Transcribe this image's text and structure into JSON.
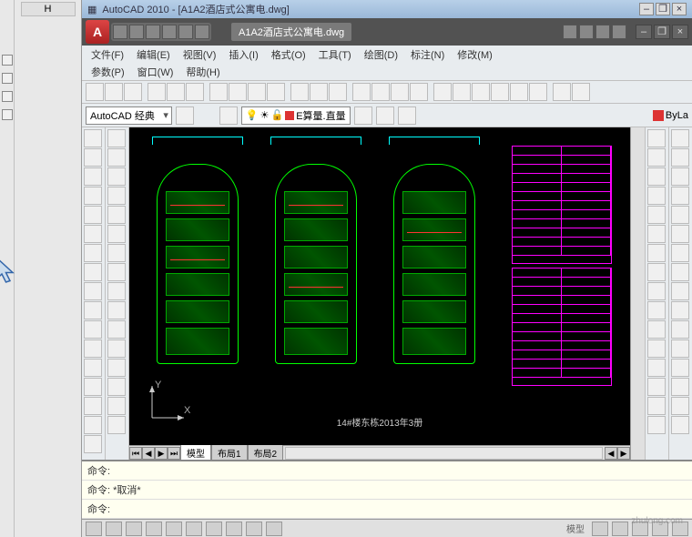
{
  "app": {
    "title": "AutoCAD 2010 - [A1A2酒店式公寓电.dwg]"
  },
  "doctab": "A1A2酒店式公寓电.dwg",
  "col_header": "H",
  "menu": {
    "file": "文件(F)",
    "edit": "编辑(E)",
    "view": "视图(V)",
    "insert": "插入(I)",
    "format": "格式(O)",
    "tools": "工具(T)",
    "draw": "绘图(D)",
    "annotate": "标注(N)",
    "modify": "修改(M)",
    "params": "参数(P)",
    "window": "窗口(W)",
    "help": "帮助(H)"
  },
  "workspace": "AutoCAD 经典",
  "layer": "E算量.直量",
  "layer_combo_right": "ByLa",
  "ucs": {
    "x": "X",
    "y": "Y"
  },
  "drawing_label": "14#楼东栋2013年3册",
  "layout_tabs": {
    "model": "模型",
    "l1": "布局1",
    "l2": "布局2"
  },
  "cmd": {
    "p1": "命令:",
    "p2": "命令: *取消*",
    "p3": "命令:"
  },
  "status": {
    "model": "模型"
  },
  "watermark": "zhulong.com"
}
